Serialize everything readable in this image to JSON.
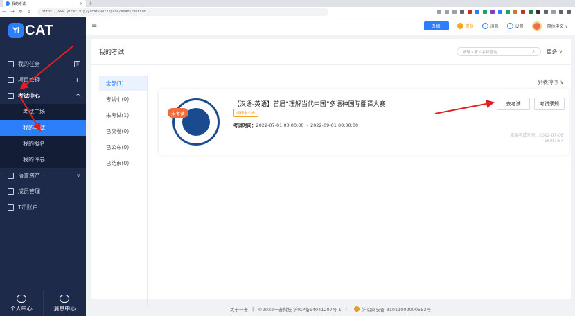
{
  "browser": {
    "tab_title": "我的考试",
    "url": "https://www.yicat.vip/yicat/workspace/exams/myExam",
    "new_tab": "+",
    "tab_close": "×"
  },
  "app": {
    "logo_badge": "Yi",
    "logo_text": "CAT",
    "brand_color": "#2d7ff9",
    "sidebar_bg": "#1e2a49"
  },
  "sidebar": {
    "items": [
      {
        "label": "我的任务",
        "icon": "task-icon",
        "right": "◎"
      },
      {
        "label": "项目管理",
        "icon": "project-icon",
        "right": "+"
      },
      {
        "label": "考试中心",
        "icon": "exam-center-icon",
        "right": "^"
      }
    ],
    "sub_items": [
      {
        "label": "考试广场"
      },
      {
        "label": "我的考试"
      },
      {
        "label": "我的报名"
      },
      {
        "label": "我的评卷"
      }
    ],
    "items_after": [
      {
        "label": "语言资产",
        "icon": "language-asset-icon",
        "right": "∨"
      },
      {
        "label": "成员管理",
        "icon": "member-icon"
      },
      {
        "label": "T币账户",
        "icon": "coin-icon"
      }
    ],
    "bottom": {
      "personal": "个人中心",
      "messages": "消息中心"
    }
  },
  "header": {
    "menu_icon": "≡",
    "upgrade": "升级",
    "vip": "冒暂",
    "message": "消息",
    "settings": "设置",
    "language": "简体中文"
  },
  "main": {
    "title": "我的考试",
    "search_placeholder": "请输入考试名称查询",
    "more": "更多",
    "sort": "列表排序",
    "filters": [
      {
        "label": "全部(1)"
      },
      {
        "label": "考试中(0)"
      },
      {
        "label": "未考试(1)"
      },
      {
        "label": "已交卷(0)"
      },
      {
        "label": "已公布(0)"
      },
      {
        "label": "已结束(0)"
      }
    ],
    "card": {
      "status_tag": "未考试",
      "title": "【汉语-英语】首届“理解当代中国”多语种国际翻译大赛",
      "score_tag": "成绩未公布",
      "time_label": "考试时间：",
      "time_value": "2022-07-01 00:00:00 ~ 2022-09-01 00:00:00",
      "go_button": "去考试",
      "notice_button": "考试须知",
      "added_label": "添加考试时间：",
      "added_date": "2022-07-06",
      "added_time": "16:07:57"
    }
  },
  "footer": {
    "about": "关于一者",
    "sep": "|",
    "copyright": "©2022一者科技 沪ICP备14041207号-1",
    "police": "沪公网安备 31011002000552号"
  }
}
